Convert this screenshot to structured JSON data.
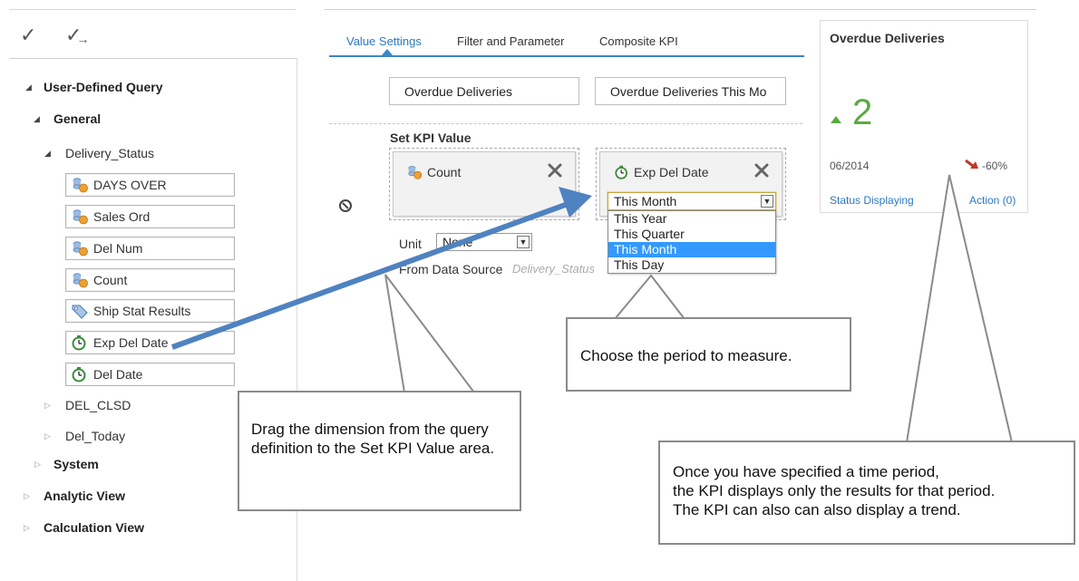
{
  "toolbar": {
    "check_glyph": "✓",
    "check_forward_glyph": "✓",
    "forward_glyph": "→"
  },
  "tree": {
    "root_label": "User-Defined Query",
    "general_label": "General",
    "delivery_status_label": "Delivery_Status",
    "fields": [
      {
        "label": "DAYS OVER",
        "icon": "measure-icon"
      },
      {
        "label": "Sales Ord",
        "icon": "measure-icon"
      },
      {
        "label": "Del Num",
        "icon": "measure-icon"
      },
      {
        "label": "Count",
        "icon": "measure-icon"
      },
      {
        "label": "Ship Stat Results",
        "icon": "tag-icon"
      },
      {
        "label": "Exp Del Date",
        "icon": "timer-icon"
      },
      {
        "label": "Del Date",
        "icon": "timer-icon"
      }
    ],
    "del_clsd_label": "DEL_CLSD",
    "del_today_label": "Del_Today",
    "system_label": "System",
    "analytic_view_label": "Analytic View",
    "calculation_view_label": "Calculation View"
  },
  "tabs": [
    {
      "label": "Value Settings",
      "active": true
    },
    {
      "label": "Filter and Parameter",
      "active": false
    },
    {
      "label": "Composite KPI",
      "active": false
    }
  ],
  "kpi_name": "Overdue Deliveries",
  "kpi_description": "Overdue Deliveries This Mo",
  "set_kpi": {
    "heading": "Set KPI Value",
    "measure_label": "Count",
    "time_label": "Exp Del Date",
    "selected_period": "This Month",
    "period_options": [
      "This Year",
      "This Quarter",
      "This Month",
      "This Day"
    ],
    "unit_label": "Unit",
    "unit_value": "None",
    "data_source_label": "From Data Source",
    "data_source_value": "Delivery_Status"
  },
  "kpi_tile": {
    "title": "Overdue Deliveries",
    "value": "2",
    "period": "06/2014",
    "trend": "-60%",
    "status_link": "Status Displaying",
    "action_link": "Action (0)"
  },
  "callouts": {
    "drag": "Drag the dimension from the query definition to the Set KPI Value area.",
    "period": "Choose the period to measure.",
    "display": {
      "line1": "Once you have specified a time period,",
      "line2": "the KPI displays only the results for that period.",
      "line3": "The KPI can also can also display a trend."
    }
  },
  "colors": {
    "accent_blue": "#2b79c2",
    "arrow_blue": "#4f82c0",
    "kpi_green": "#5aaa44",
    "trend_red": "#c0392b",
    "selected_option": "#3399ff"
  }
}
